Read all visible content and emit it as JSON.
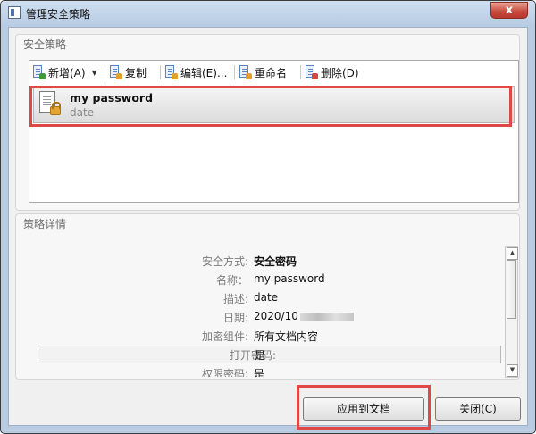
{
  "window": {
    "title": "管理安全策略",
    "close_glyph": "x"
  },
  "policies_group": {
    "title": "安全策略"
  },
  "toolbar": [
    {
      "label": "新增(A)",
      "has_dropdown": true,
      "icon": "add-doc-icon",
      "badge_color": "#3c9a3c"
    },
    {
      "label": "复制",
      "icon": "copy-doc-icon",
      "badge_color": "#e0a12d"
    },
    {
      "label": "编辑(E)...",
      "icon": "edit-doc-icon",
      "badge_color": "#e0a12d"
    },
    {
      "label": "重命名",
      "icon": "rename-doc-icon",
      "badge_color": "#e0a12d"
    },
    {
      "label": "删除(D)",
      "icon": "delete-doc-icon",
      "badge_color": "#d84343"
    }
  ],
  "policy_item": {
    "name": "my password",
    "subtitle": "date",
    "icon": "locked-document-icon"
  },
  "details_group": {
    "title": "策略详情"
  },
  "details": [
    {
      "label": "安全方式:",
      "value": "安全密码",
      "bold": true
    },
    {
      "label": "名称：",
      "value": "my password"
    },
    {
      "label": "描述:",
      "value": "date"
    },
    {
      "label": "日期:",
      "value": "2020/10",
      "redacted": true
    },
    {
      "label": "加密组件:",
      "value": "所有文档内容"
    },
    {
      "label": "打开密码:",
      "value": "是",
      "boxed": true
    },
    {
      "label": "权限密码:",
      "value": "是"
    }
  ],
  "buttons": {
    "apply": "应用到文档",
    "close": "关闭(C)"
  },
  "colors": {
    "highlight": "#e04848",
    "title_bar": "#b9cbe1"
  }
}
